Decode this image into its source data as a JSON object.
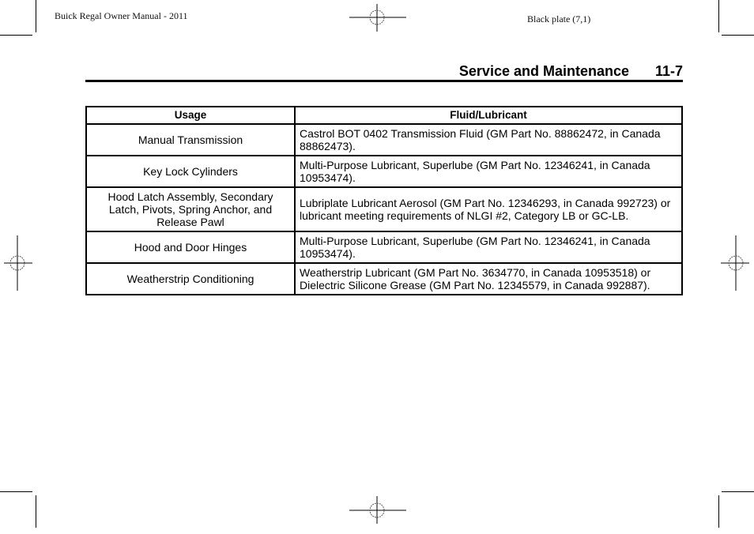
{
  "page_header": {
    "manual_title": "Buick Regal Owner Manual - 2011",
    "plate_label": "Black plate (7,1)"
  },
  "section": {
    "title": "Service and Maintenance",
    "page_number": "11-7"
  },
  "table": {
    "columns": [
      "Usage",
      "Fluid/Lubricant"
    ],
    "rows": [
      {
        "usage": "Manual Transmission",
        "fluid": "Castrol BOT 0402 Transmission Fluid (GM Part No. 88862472, in Canada 88862473)."
      },
      {
        "usage": "Key Lock Cylinders",
        "fluid": "Multi-Purpose Lubricant, Superlube (GM Part No. 12346241, in Canada 10953474)."
      },
      {
        "usage": "Hood Latch Assembly, Secondary Latch, Pivots, Spring Anchor, and Release Pawl",
        "fluid": "Lubriplate Lubricant Aerosol (GM Part No. 12346293, in Canada 992723) or lubricant meeting requirements of NLGI #2, Category LB or GC-LB."
      },
      {
        "usage": "Hood and Door Hinges",
        "fluid": "Multi-Purpose Lubricant, Superlube (GM Part No. 12346241, in Canada 10953474)."
      },
      {
        "usage": "Weatherstrip Conditioning",
        "fluid": "Weatherstrip Lubricant (GM Part No. 3634770, in Canada 10953518) or Dielectric Silicone Grease (GM Part No. 12345579, in Canada 992887)."
      }
    ]
  },
  "icons": {
    "registration_mark": "registration-crosshair",
    "crop_mark": "corner-crop-mark"
  }
}
